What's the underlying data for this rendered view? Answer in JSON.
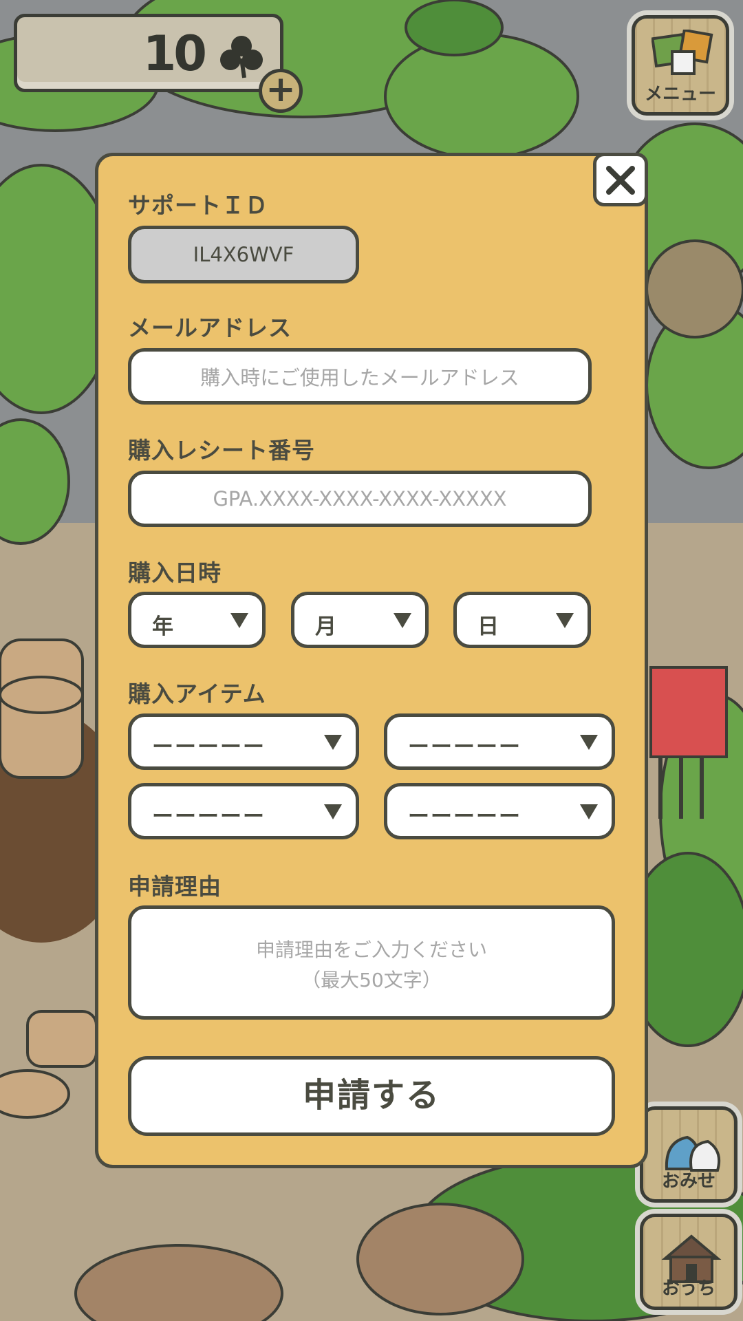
{
  "hud": {
    "clover_count": "10",
    "menu_label": "メニュー",
    "shop_label": "おみせ",
    "home_label": "おうち"
  },
  "form": {
    "support_id_label": "サポートＩＤ",
    "support_id_value": "IL4X6WVF",
    "email_label": "メールアドレス",
    "email_placeholder": "購入時にご使用したメールアドレス",
    "receipt_label": "購入レシート番号",
    "receipt_placeholder": "GPA.XXXX-XXXX-XXXX-XXXXX",
    "date_label": "購入日時",
    "year_label": "年",
    "month_label": "月",
    "day_label": "日",
    "items_label": "購入アイテム",
    "item_placeholder": "ーーーーー",
    "reason_label": "申請理由",
    "reason_placeholder_line1": "申請理由をご入力ください",
    "reason_placeholder_line2": "（最大50文字）",
    "submit_label": "申請する"
  },
  "colors": {
    "modal_bg": "#ecc26c",
    "border": "#4a4b40",
    "placeholder": "#a6a6a6"
  },
  "icons": [
    "clover-icon",
    "plus-icon",
    "close-icon",
    "dropdown-arrow-icon",
    "menu-icon",
    "shop-bags-icon",
    "house-icon"
  ]
}
